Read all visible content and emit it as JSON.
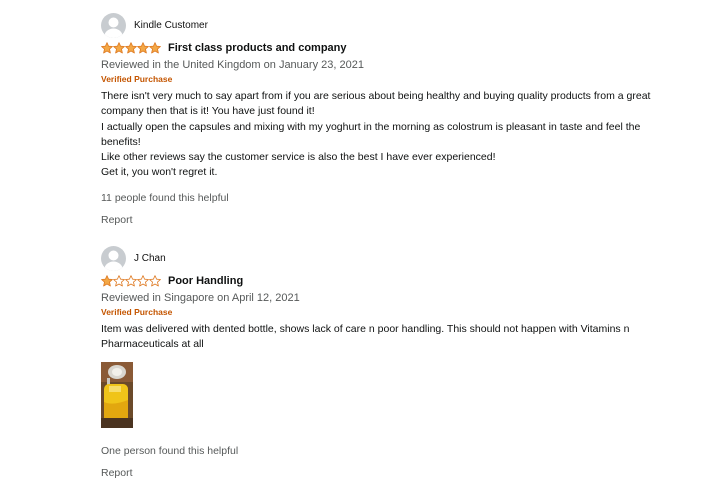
{
  "colors": {
    "star": "#f3a847",
    "star_empty": "#ffffff",
    "star_outline": "#de7921",
    "verified": "#c45500",
    "meta_text": "#565959"
  },
  "reviews": [
    {
      "profile_name": "Kindle Customer",
      "rating": 5,
      "title": "First class products and company",
      "date": "Reviewed in the United Kingdom on January 23, 2021",
      "verified": "Verified Purchase",
      "body": [
        "There isn't very much to say apart from if you are serious about being healthy and buying quality products from a great company then that is it! You have just found it!",
        "I actually open the capsules and mixing with my yoghurt in the morning as colostrum is pleasant in taste and feel the benefits!",
        "Like other reviews say the customer service is also the best I have ever experienced!",
        "Get it, you won't regret it."
      ],
      "helpful": "11 people found this helpful",
      "report": "Report"
    },
    {
      "profile_name": "J Chan",
      "rating": 1,
      "title": "Poor Handling",
      "date": "Reviewed in Singapore on April 12, 2021",
      "verified": "Verified Purchase",
      "body": [
        "Item was delivered with dented bottle, shows lack of care n poor handling. This should not happen with Vitamins n Pharmaceuticals at all"
      ],
      "helpful": "One person found this helpful",
      "report": "Report"
    }
  ]
}
